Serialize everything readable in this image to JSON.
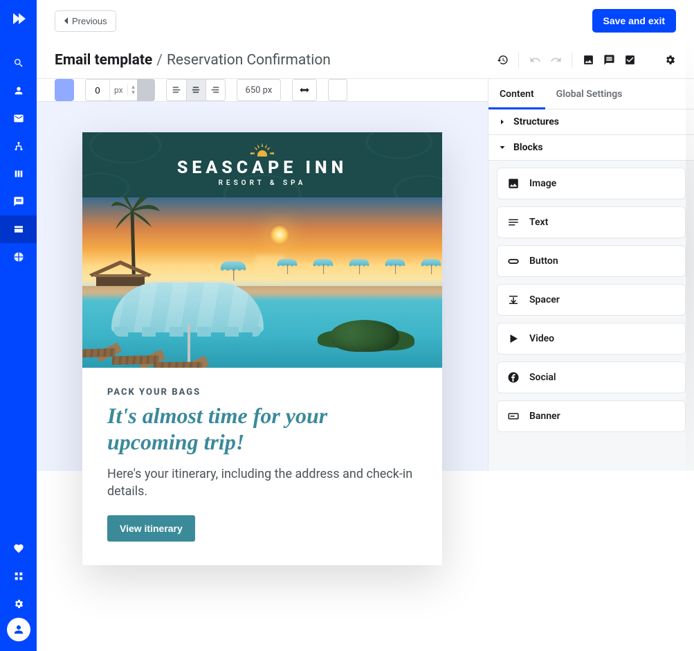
{
  "sidenav": {
    "items": [
      {
        "name": "search-icon"
      },
      {
        "name": "person-icon"
      },
      {
        "name": "mail-icon"
      },
      {
        "name": "hierarchy-icon"
      },
      {
        "name": "columns-icon"
      },
      {
        "name": "chat-icon"
      },
      {
        "name": "window-icon",
        "active": true
      },
      {
        "name": "pie-chart-icon"
      }
    ],
    "bottom_items": [
      {
        "name": "heart-icon"
      },
      {
        "name": "sliders-icon"
      },
      {
        "name": "gear-icon"
      }
    ]
  },
  "topbar": {
    "previous_label": "Previous",
    "save_label": "Save and exit"
  },
  "titlebar": {
    "section": "Email template",
    "separator": "/",
    "name": "Reservation Confirmation"
  },
  "toolbar": {
    "padding_value": "0",
    "padding_unit": "px",
    "width_label": "650 px"
  },
  "right_panel": {
    "tabs": [
      {
        "label": "Content",
        "active": true
      },
      {
        "label": "Global Settings",
        "active": false
      }
    ],
    "sections": {
      "structures_label": "Structures",
      "blocks_label": "Blocks"
    },
    "blocks": [
      {
        "name": "image-icon",
        "label": "Image"
      },
      {
        "name": "text-icon",
        "label": "Text"
      },
      {
        "name": "button-icon",
        "label": "Button"
      },
      {
        "name": "spacer-icon",
        "label": "Spacer"
      },
      {
        "name": "video-icon",
        "label": "Video"
      },
      {
        "name": "social-icon",
        "label": "Social"
      },
      {
        "name": "banner-icon",
        "label": "Banner"
      }
    ]
  },
  "email": {
    "brand_title": "SEASCAPE INN",
    "brand_subtitle": "RESORT & SPA",
    "kicker": "PACK YOUR BAGS",
    "headline": "It's almost time for your upcoming trip!",
    "body": "Here's your itinerary, including the address and check-in details.",
    "cta_label": "View itinerary"
  },
  "colors": {
    "brand_primary": "#0047ff",
    "accent_teal": "#3a8a9a",
    "banner_bg": "#1d4a4a"
  }
}
